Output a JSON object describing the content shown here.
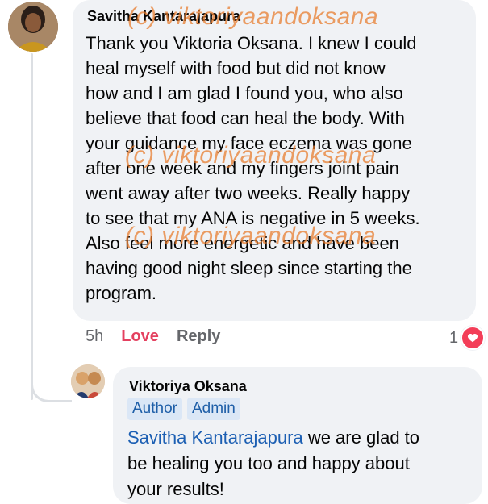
{
  "main_comment": {
    "author": "Savitha Kantarajapura",
    "lines": [
      "Thank you Viktoria Oksana. I knew I could",
      "heal myself with food but did not know",
      "how and I am glad I found you, who also",
      "believe that food can heal the body. With",
      "your guidance my face eczema was gone",
      "after one week and my fingers joint pain",
      "went away after two weeks. Really happy",
      "to see that my ANA is negative in 5 weeks.",
      "Also feel more energetic and have been",
      "having good night sleep since starting the",
      "program."
    ],
    "timestamp": "5h",
    "love_label": "Love",
    "reply_label": "Reply",
    "reaction_count": "1",
    "reaction_color": "#f33e58"
  },
  "reply_comment": {
    "author": "Viktoriya Oksana",
    "badges": [
      "Author",
      "Admin"
    ],
    "mention": "Savitha Kantarajapura",
    "line1_rest": " we are glad to",
    "line2": "be healing you too and happy about",
    "line3": "your results!"
  },
  "watermark": "(c) viktoriyaandoksana",
  "colors": {
    "bubble": "#f0f2f5",
    "mention": "#1c5fb3",
    "love": "#e4405f",
    "watermark": "#e87828"
  }
}
